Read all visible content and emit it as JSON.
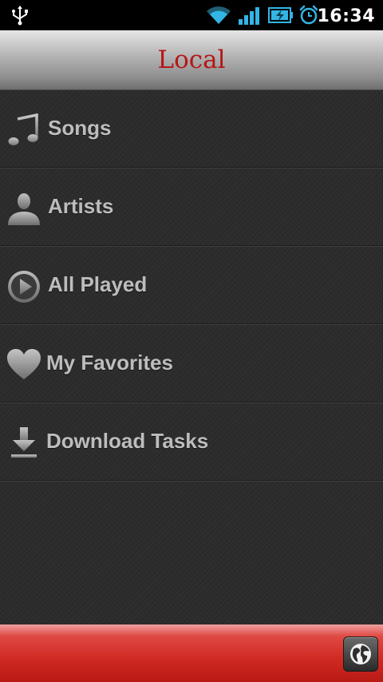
{
  "status_bar": {
    "time": "16:34",
    "icons": [
      "usb-icon",
      "wifi-icon",
      "signal-icon",
      "battery-charging-icon",
      "alarm-clock-icon"
    ],
    "accent_color": "#33b5e5"
  },
  "header": {
    "title": "Local",
    "title_color": "#b51616"
  },
  "menu": {
    "items": [
      {
        "label": "Songs",
        "icon": "music-note-icon"
      },
      {
        "label": "Artists",
        "icon": "person-icon"
      },
      {
        "label": "All Played",
        "icon": "play-circle-icon"
      },
      {
        "label": "My Favorites",
        "icon": "heart-icon"
      },
      {
        "label": "Download Tasks",
        "icon": "download-icon"
      }
    ]
  },
  "footer": {
    "bar_color": "#cf2a22",
    "button_icon": "globe-icon"
  }
}
